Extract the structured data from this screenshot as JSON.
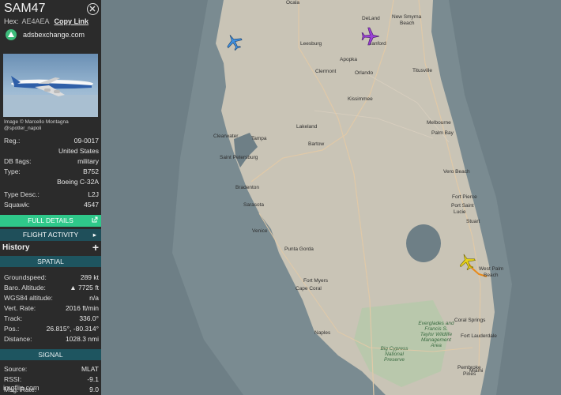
{
  "aircraft": {
    "callsign": "SAM47",
    "hex_label": "Hex:",
    "hex_value": "AE4AEA",
    "copy_link": "Copy Link",
    "source_site": "adsbexchange.com",
    "photo_credit": "Image © Marcello Montagna @spotter_napoli"
  },
  "details": [
    {
      "label": "Reg.:",
      "value": "09-0017"
    },
    {
      "label": "",
      "value": "United States"
    },
    {
      "label": "DB flags:",
      "value": "military"
    },
    {
      "label": "Type:",
      "value": "B752"
    },
    {
      "label": "",
      "value": "Boeing C-32A"
    },
    {
      "label": "Type Desc.:",
      "value": "L2J"
    },
    {
      "label": "Squawk:",
      "value": "4547"
    }
  ],
  "buttons": {
    "full_details": "FULL DETAILS",
    "flight_activity": "FLIGHT ACTIVITY",
    "history": "History",
    "history_plus": "+"
  },
  "sections": {
    "spatial": "SPATIAL",
    "signal": "SIGNAL"
  },
  "spatial": [
    {
      "label": "Groundspeed:",
      "value": "289 kt"
    },
    {
      "label": "Baro. Altitude:",
      "value": "▲ 7725 ft"
    },
    {
      "label": "WGS84 altitude:",
      "value": "n/a"
    },
    {
      "label": "Vert. Rate:",
      "value": "2016 ft/min"
    },
    {
      "label": "Track:",
      "value": "336.0°"
    },
    {
      "label": "Pos.:",
      "value": "26.815°, -80.314°"
    },
    {
      "label": "Distance:",
      "value": "1028.3 nmi"
    }
  ],
  "signal": [
    {
      "label": "Source:",
      "value": "MLAT"
    },
    {
      "label": "RSSI:",
      "value": "-9.1"
    },
    {
      "label": "Msg. Rate:",
      "value": "9.0"
    }
  ],
  "watermark": "imgflip.com",
  "map": {
    "cities": [
      {
        "name": "Ocala",
        "id": "ocala"
      },
      {
        "name": "DeLand",
        "id": "deland"
      },
      {
        "name": "New Smyrna",
        "id": "new-smyrna"
      },
      {
        "name": "Beach",
        "id": "nsb-beach"
      },
      {
        "name": "Leesburg",
        "id": "leesburg"
      },
      {
        "name": "Sanford",
        "id": "sanford"
      },
      {
        "name": "Apopka",
        "id": "apopka"
      },
      {
        "name": "Clermont",
        "id": "clermont"
      },
      {
        "name": "Orlando",
        "id": "orlando"
      },
      {
        "name": "Titusville",
        "id": "titusville"
      },
      {
        "name": "Kissimmee",
        "id": "kissimmee"
      },
      {
        "name": "Lakeland",
        "id": "lakeland"
      },
      {
        "name": "Melbourne",
        "id": "melbourne"
      },
      {
        "name": "Palm Bay",
        "id": "palm-bay"
      },
      {
        "name": "Clearwater",
        "id": "clearwater"
      },
      {
        "name": "Tampa",
        "id": "tampa"
      },
      {
        "name": "Bartow",
        "id": "bartow"
      },
      {
        "name": "Saint Petersburg",
        "id": "st-petersburg"
      },
      {
        "name": "Vero Beach",
        "id": "vero-beach"
      },
      {
        "name": "Bradenton",
        "id": "bradenton"
      },
      {
        "name": "Fort Pierce",
        "id": "fort-pierce"
      },
      {
        "name": "Port Saint",
        "id": "port-st"
      },
      {
        "name": "Lucie",
        "id": "lucie"
      },
      {
        "name": "Sarasota",
        "id": "sarasota"
      },
      {
        "name": "Stuart",
        "id": "stuart"
      },
      {
        "name": "Venice",
        "id": "venice"
      },
      {
        "name": "Punta Gorda",
        "id": "punta-gorda"
      },
      {
        "name": "West Palm",
        "id": "west-palm"
      },
      {
        "name": "Beach",
        "id": "wpb-beach"
      },
      {
        "name": "Fort Myers",
        "id": "fort-myers"
      },
      {
        "name": "Cape Coral",
        "id": "cape-coral"
      },
      {
        "name": "Coral Springs",
        "id": "coral-springs"
      },
      {
        "name": "Fort Lauderdale",
        "id": "fort-lauderdale"
      },
      {
        "name": "Naples",
        "id": "naples"
      },
      {
        "name": "Pembroke",
        "id": "pembroke"
      },
      {
        "name": "Pines",
        "id": "pines"
      },
      {
        "name": "Miami",
        "id": "miami"
      }
    ],
    "parks": [
      {
        "name": "Everglades and Francis S. Taylor Wildlife Management Area",
        "id": "everglades-wma"
      },
      {
        "name": "Big Cypress National Preserve",
        "id": "big-cypress"
      }
    ],
    "colors": {
      "water": "#6e7f86",
      "land": "#c9c4b6",
      "selected_aircraft": "#e6d21a",
      "other_aircraft_blue": "#3d8fe0",
      "other_aircraft_purple": "#9a3fd6",
      "track": "#e88a1a"
    }
  }
}
